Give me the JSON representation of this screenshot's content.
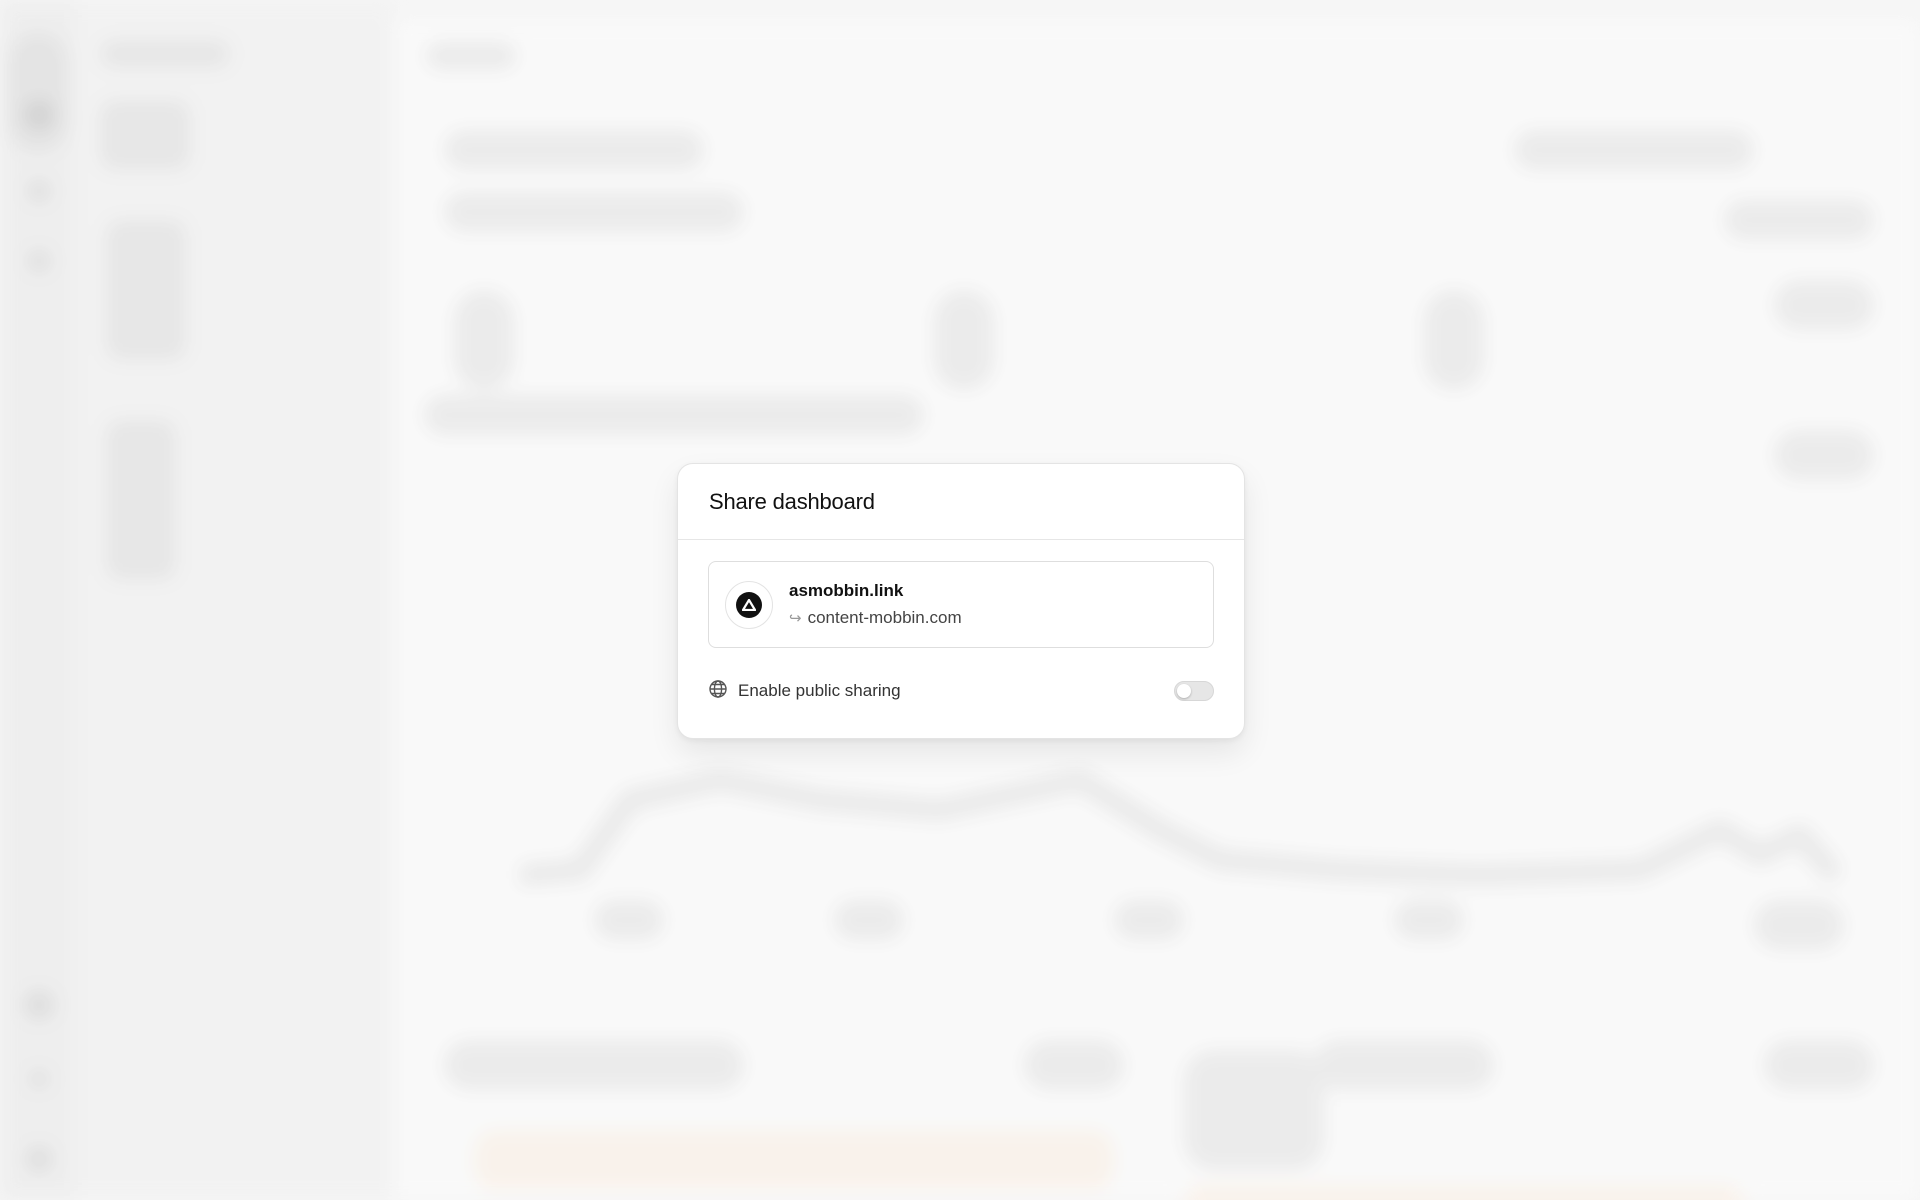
{
  "dialog": {
    "title": "Share dashboard",
    "domain": {
      "name": "asmobbin.link",
      "target": "content-mobbin.com",
      "logo_icon": "triangle-logo-icon",
      "redirect_icon": "redirect-arrow-icon"
    },
    "public_sharing": {
      "label": "Enable public sharing",
      "icon": "globe-icon",
      "enabled": false
    }
  },
  "colors": {
    "dialog_background": "#ffffff",
    "backdrop": "#f4f4f4",
    "logo": "#111111",
    "toggle_off": "#e6e6e6"
  }
}
